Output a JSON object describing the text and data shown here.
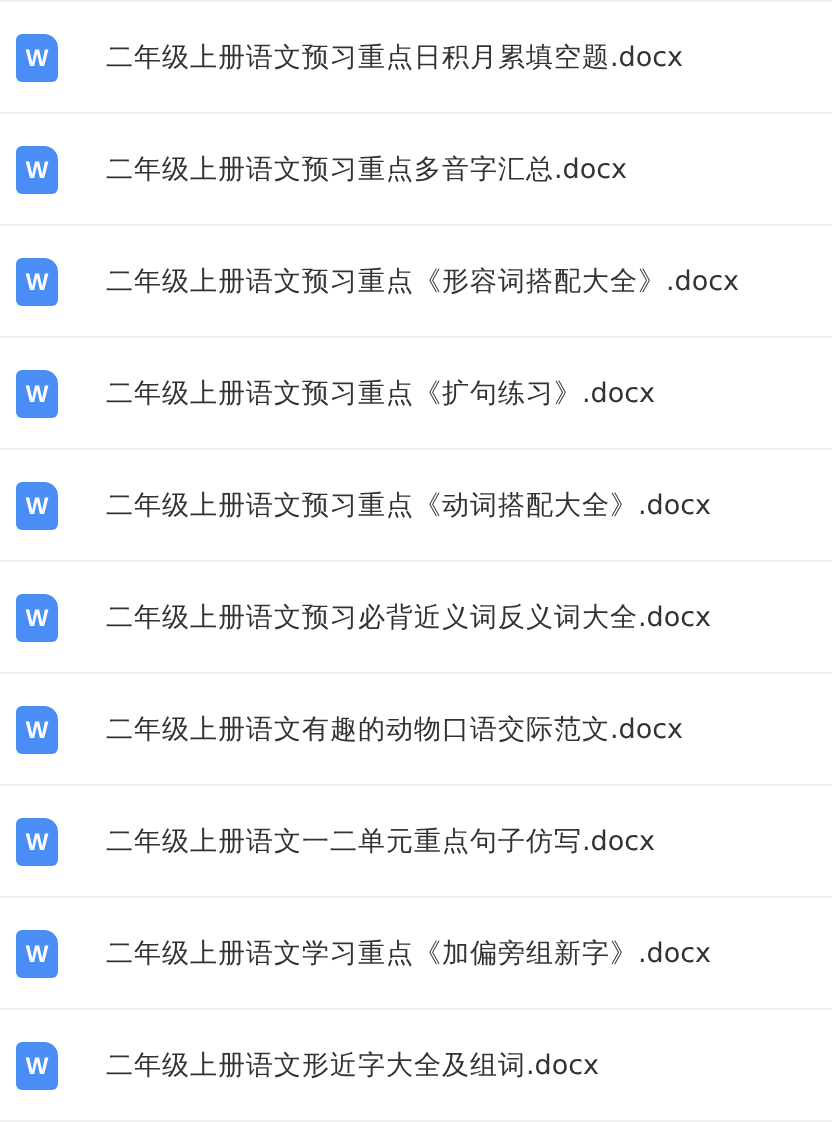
{
  "files": [
    {
      "icon_label": "W",
      "name": "二年级上册语文预习重点日积月累填空题.docx"
    },
    {
      "icon_label": "W",
      "name": "二年级上册语文预习重点多音字汇总.docx"
    },
    {
      "icon_label": "W",
      "name": "二年级上册语文预习重点《形容词搭配大全》.docx"
    },
    {
      "icon_label": "W",
      "name": "二年级上册语文预习重点《扩句练习》.docx"
    },
    {
      "icon_label": "W",
      "name": "二年级上册语文预习重点《动词搭配大全》.docx"
    },
    {
      "icon_label": "W",
      "name": "二年级上册语文预习必背近义词反义词大全.docx"
    },
    {
      "icon_label": "W",
      "name": "二年级上册语文有趣的动物口语交际范文.docx"
    },
    {
      "icon_label": "W",
      "name": "二年级上册语文一二单元重点句子仿写.docx"
    },
    {
      "icon_label": "W",
      "name": "二年级上册语文学习重点《加偏旁组新字》.docx"
    },
    {
      "icon_label": "W",
      "name": "二年级上册语文形近字大全及组词.docx"
    }
  ]
}
